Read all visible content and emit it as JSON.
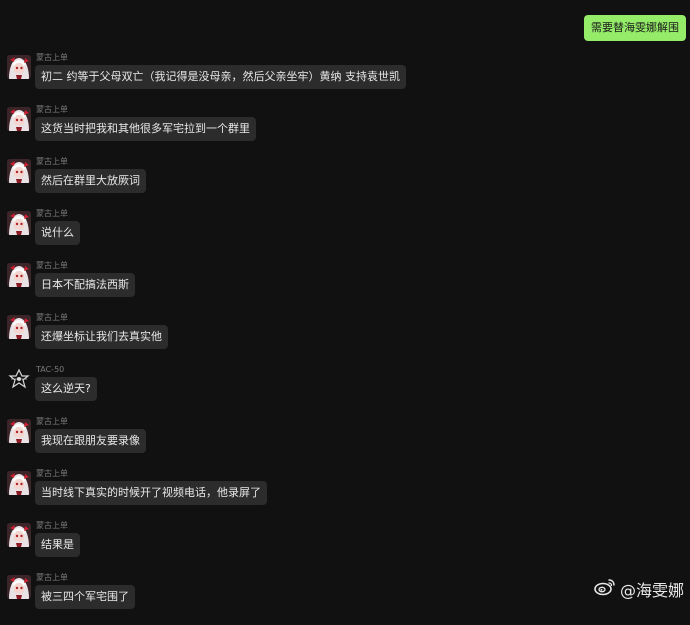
{
  "outgoing": {
    "text": "需要替海雯娜解围"
  },
  "messages": [
    {
      "sender": "蒙古上单",
      "avatar": "anime-girl-avatar",
      "text": "初二 约等于父母双亡（我记得是没母亲，然后父亲坐牢）黄纳 支持袁世凯"
    },
    {
      "sender": "蒙古上单",
      "avatar": "anime-girl-avatar",
      "text": "这货当时把我和其他很多军宅拉到一个群里"
    },
    {
      "sender": "蒙古上单",
      "avatar": "anime-girl-avatar",
      "text": "然后在群里大放厥词"
    },
    {
      "sender": "蒙古上单",
      "avatar": "anime-girl-avatar",
      "text": "说什么"
    },
    {
      "sender": "蒙古上单",
      "avatar": "anime-girl-avatar",
      "text": "日本不配搞法西斯"
    },
    {
      "sender": "蒙古上单",
      "avatar": "anime-girl-avatar",
      "text": "还爆坐标让我们去真实他"
    },
    {
      "sender": "TAC-50",
      "avatar": "emblem-avatar",
      "text": "这么逆天?"
    },
    {
      "sender": "蒙古上单",
      "avatar": "anime-girl-avatar",
      "text": "我现在跟朋友要录像"
    },
    {
      "sender": "蒙古上单",
      "avatar": "anime-girl-avatar",
      "text": "当时线下真实的时候开了视频电话，他录屏了"
    },
    {
      "sender": "蒙古上单",
      "avatar": "anime-girl-avatar",
      "text": "结果是"
    },
    {
      "sender": "蒙古上单",
      "avatar": "anime-girl-avatar",
      "text": "被三四个军宅围了"
    }
  ],
  "watermark": {
    "text": "@海雯娜",
    "icon": "weibo-logo-icon"
  },
  "colors": {
    "background": "#111111",
    "incoming_bubble": "#2c2c2c",
    "outgoing_bubble": "#95ec69",
    "sender_name": "#7a7a7a"
  }
}
